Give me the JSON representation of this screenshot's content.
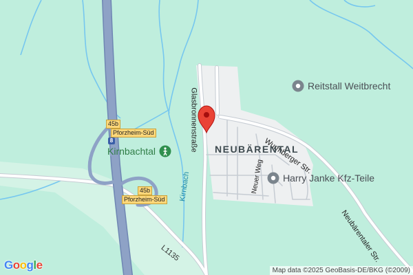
{
  "map": {
    "place_label": "NEUBÄRENTAL",
    "streets": {
      "glasbronnen": "Glasbronnenstraße",
      "wurmberger": "Wurmberger Str.",
      "neubaerentaler": "Neubärentaler Str.",
      "neuer_weg": "Neuer Weg",
      "l1135": "L1135"
    },
    "water": {
      "kirnbach": "Kirnbach"
    },
    "exits": [
      {
        "number": "45b",
        "name": "Pforzheim-Süd"
      },
      {
        "number": "45b",
        "name": "Pforzheim-Süd"
      }
    ],
    "highway_shield": "8",
    "pois": {
      "reitstall": "Reitstall Weitbrecht",
      "harry_janke": "Harry Janke Kfz-Teile",
      "kirnbachtal": "Kirnbachtal"
    },
    "attribution": "Map data ©2025 GeoBasis-DE/BKG (©2009)",
    "logo": [
      "G",
      "o",
      "o",
      "g",
      "l",
      "e"
    ],
    "colors": {
      "forest": "#bfeedd",
      "settlement": "#eef0f1",
      "road": "#ffffff",
      "road_outline": "#c6ccd3",
      "motorway": "#8ea2c6",
      "water": "#76c7ef",
      "marker": "#ea4335"
    }
  }
}
